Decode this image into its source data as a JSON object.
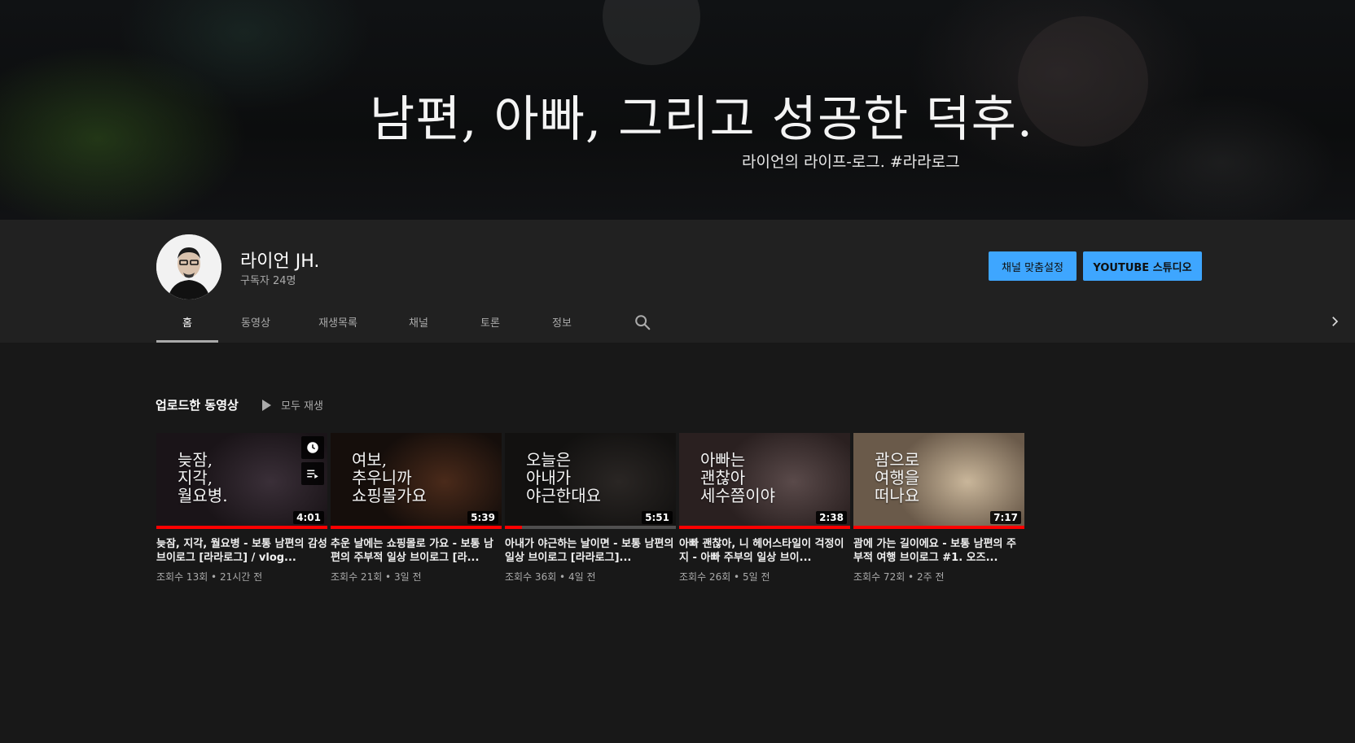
{
  "banner": {
    "title": "남편, 아빠, 그리고 성공한 덕후.",
    "subtitle": "라이언의 라이프-로그. #라라로그"
  },
  "channel": {
    "name": "라이언 JH.",
    "subscribers": "구독자 24명",
    "customize_label": "채널 맞춤설정",
    "studio_label": "YOUTUBE 스튜디오"
  },
  "tabs": [
    {
      "label": "홈",
      "active": true
    },
    {
      "label": "동영상"
    },
    {
      "label": "재생목록"
    },
    {
      "label": "채널"
    },
    {
      "label": "토론"
    },
    {
      "label": "정보"
    }
  ],
  "section": {
    "title": "업로드한 동영상",
    "play_all_label": "모두 재생"
  },
  "videos": [
    {
      "thumb_text": "늦잠,\n지각,\n월요병.",
      "duration": "4:01",
      "watched": 1.0,
      "title": "늦잠, 지각, 월요병 - 보통 남편의 감성 브이로그 [라라로그] / vlog...",
      "meta": "조회수 13회 • 21시간 전",
      "colors": [
        "#3a2f38",
        "#1a1418"
      ]
    },
    {
      "thumb_text": "여보,\n추우니까\n쇼핑몰가요",
      "duration": "5:39",
      "watched": 1.0,
      "title": "추운 날에는 쇼핑몰로 가요 - 보통 남편의 주부적 일상 브이로그 [라...",
      "meta": "조회수 21회 • 3일 전",
      "colors": [
        "#4a2a1a",
        "#150e0b"
      ]
    },
    {
      "thumb_text": "오늘은\n아내가\n야근한대요",
      "duration": "5:51",
      "watched": 0.1,
      "title": "아내가 야근하는 날이면 - 보통 남편의 일상 브이로그 [라라로그]...",
      "meta": "조회수 36회 • 4일 전",
      "colors": [
        "#2a2624",
        "#121110"
      ]
    },
    {
      "thumb_text": "아빠는\n괜찮아\n세수쯤이야",
      "duration": "2:38",
      "watched": 1.0,
      "title": "아빠 괜찮아, 니 헤어스타일이 걱정이지 - 아빠 주부의 일상 브이...",
      "meta": "조회수 26회 • 5일 전",
      "colors": [
        "#5a4a4a",
        "#2a2020"
      ]
    },
    {
      "thumb_text": "괌으로\n여행을\n떠나요",
      "duration": "7:17",
      "watched": 1.0,
      "title": "괌에 가는 길이에요 - 보통 남편의 주부적 여행 브이로그 #1. 오즈...",
      "meta": "조회수 72회 • 2주 전",
      "colors": [
        "#c9b69a",
        "#6a5a4a"
      ]
    }
  ]
}
